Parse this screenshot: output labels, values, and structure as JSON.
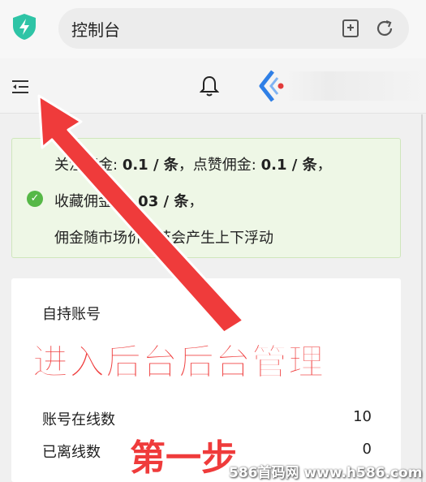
{
  "browser": {
    "address_text": "控制台"
  },
  "app_header": {
    "icons": [
      "menu-collapse-icon",
      "bell-icon",
      "app-logo-icon"
    ]
  },
  "notice": {
    "line1_prefix": "关注佣金:",
    "line1_value1": "0.1 / 条",
    "line1_mid": "，点赞佣金:",
    "line1_value2": "0.1 / 条",
    "line1_suffix": "，",
    "line2_prefix": "收藏佣金:",
    "line2_value": "0.03 / 条",
    "line2_suffix": "，",
    "line3": "佣金随市场价调节会产生上下浮动"
  },
  "card": {
    "title": "自持账号",
    "rows": [
      {
        "label": "账号在线数",
        "value": "10"
      },
      {
        "label": "已离线数",
        "value": "0"
      }
    ]
  },
  "overlay": {
    "headline": "进入后台后台管理",
    "step": "第一步",
    "watermark": "586首码网 www.h586.com"
  },
  "colors": {
    "annotation_red": "#ef3b3b",
    "notice_green": "#56b847",
    "shield_teal": "#2ec4a6",
    "logo_blue": "#2f7fe6"
  }
}
